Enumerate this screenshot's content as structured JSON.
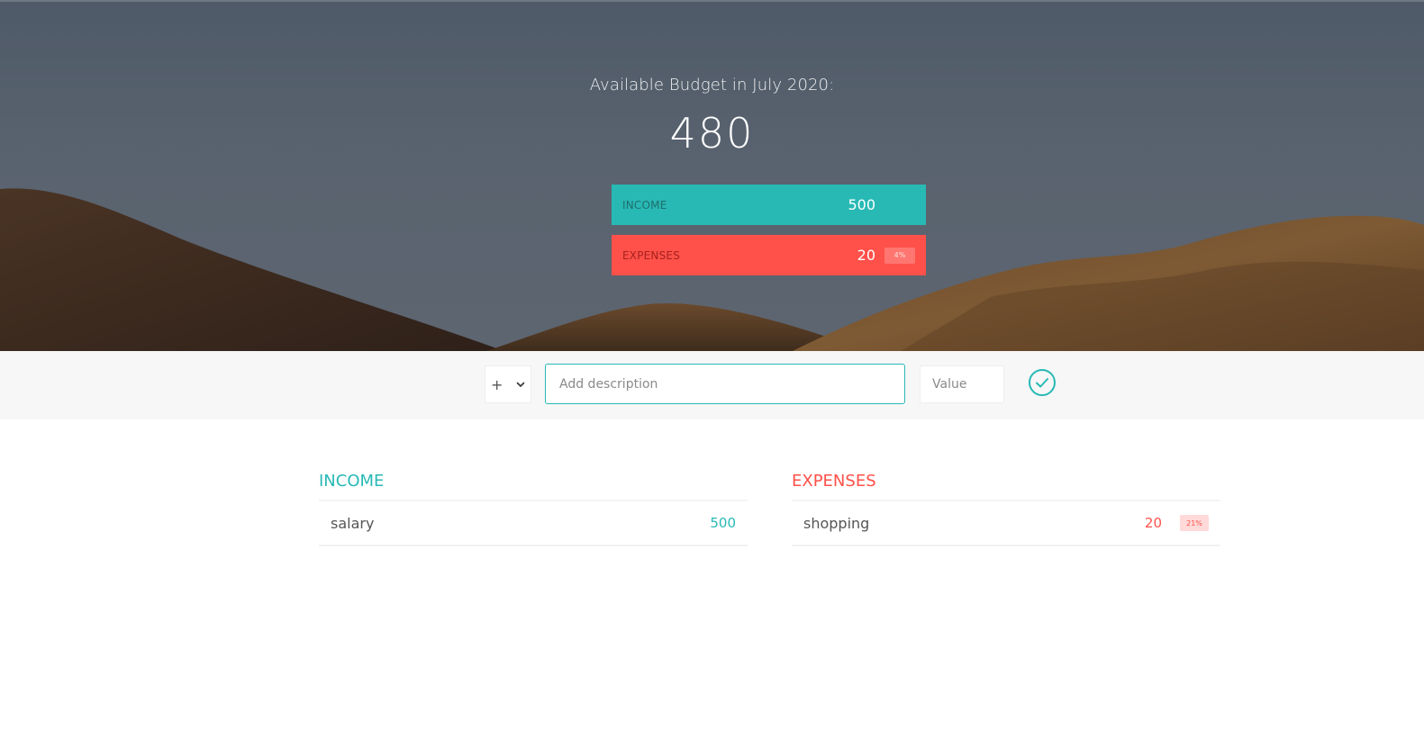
{
  "budget": {
    "title": "Available Budget in July 2020:",
    "value": "480",
    "income_label": "INCOME",
    "income_value": "500",
    "expenses_label": "EXPENSES",
    "expenses_value": "20",
    "expenses_percentage": "4%"
  },
  "add_bar": {
    "type_value": "+",
    "description_placeholder": "Add description",
    "value_placeholder": "Value"
  },
  "income_list": {
    "title": "INCOME",
    "items": [
      {
        "description": "salary",
        "value": "500"
      }
    ]
  },
  "expenses_list": {
    "title": "EXPENSES",
    "items": [
      {
        "description": "shopping",
        "value": "20",
        "percentage": "21%"
      }
    ]
  },
  "colors": {
    "income": "#28b9b5",
    "expenses": "#ff5049",
    "sky": "#59636f",
    "hills": "#6b4a2b"
  },
  "icons": {
    "add_button": "check-circle-icon",
    "select_arrow": "chevron-down-icon"
  }
}
